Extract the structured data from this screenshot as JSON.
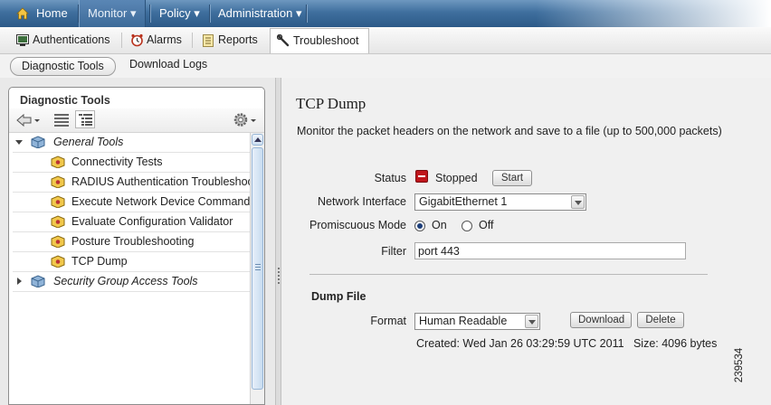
{
  "topnav": {
    "home": "Home",
    "monitor": "Monitor ▾",
    "policy": "Policy ▾",
    "administration": "Administration ▾"
  },
  "subnav": {
    "authentications": "Authentications",
    "alarms": "Alarms",
    "reports": "Reports",
    "troubleshoot": "Troubleshoot"
  },
  "toolsbar": {
    "diagnostic_tools": "Diagnostic Tools",
    "download_logs": "Download Logs"
  },
  "leftpanel": {
    "title": "Diagnostic Tools",
    "tree": {
      "general_tools": "General Tools",
      "items": [
        "Connectivity Tests",
        "RADIUS Authentication Troubleshoot",
        "Execute Network Device Command",
        "Evaluate Configuration Validator",
        "Posture Troubleshooting",
        "TCP Dump"
      ],
      "sga_tools": "Security Group Access Tools"
    }
  },
  "main": {
    "title": "TCP Dump",
    "description": "Monitor the packet headers on the network and save to a file (up to 500,000 packets)",
    "status_label": "Status",
    "status_value": "Stopped",
    "start_button": "Start",
    "interface_label": "Network Interface",
    "interface_value": "GigabitEthernet 1",
    "promiscuous_label": "Promiscuous Mode",
    "promiscuous_on": "On",
    "promiscuous_off": "Off",
    "promiscuous_selected": "On",
    "filter_label": "Filter",
    "filter_value": "port 443",
    "dump_file_title": "Dump File",
    "format_label": "Format",
    "format_value": "Human Readable",
    "download_button": "Download",
    "delete_button": "Delete",
    "created_info": "Created: Wed Jan 26 03:29:59 UTC 2011   Size: 4096 bytes"
  },
  "figure_id": "239534",
  "colors": {
    "nav_blue": "#3f6f9e",
    "status_red": "#c0161c",
    "content_bg": "#f0f0f0"
  }
}
